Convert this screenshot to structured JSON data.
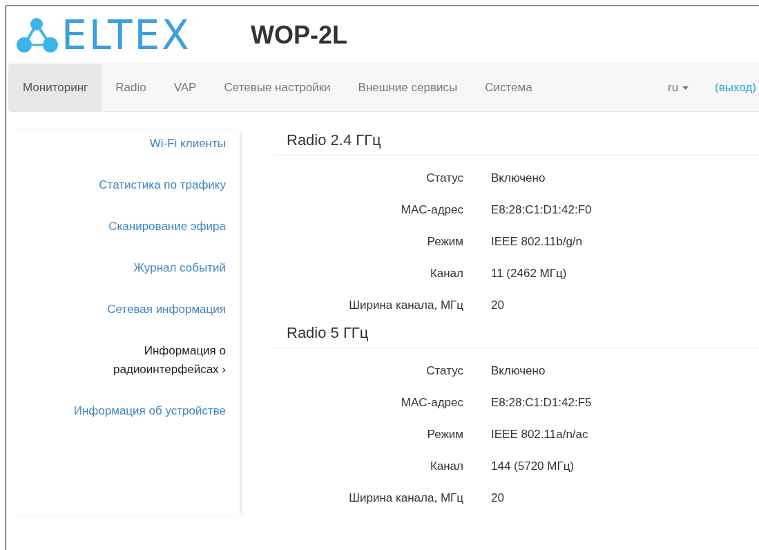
{
  "logo": {
    "text": "ELTEX"
  },
  "title": "WOP-2L",
  "tabs": [
    {
      "label": "Мониторинг",
      "selected": true
    },
    {
      "label": "Radio",
      "selected": false
    },
    {
      "label": "VAP",
      "selected": false
    },
    {
      "label": "Сетевые настройки",
      "selected": false
    },
    {
      "label": "Внешние сервисы",
      "selected": false
    },
    {
      "label": "Система",
      "selected": false
    }
  ],
  "language": "ru",
  "logout": "(выход)",
  "sidebar": {
    "items": [
      {
        "label": "Wi-Fi клиенты",
        "selected": false
      },
      {
        "label": "Статистика по трафику",
        "selected": false
      },
      {
        "label": "Сканирование эфира",
        "selected": false
      },
      {
        "label": "Журнал событий",
        "selected": false
      },
      {
        "label": "Сетевая информация",
        "selected": false
      },
      {
        "label": "Информация о радиоинтерфейсах ›",
        "selected": true
      },
      {
        "label": "Информация об устройстве",
        "selected": false
      }
    ]
  },
  "sections": [
    {
      "title": "Radio 2.4 ГГц",
      "rows": [
        {
          "label": "Статус",
          "value": "Включено"
        },
        {
          "label": "MAC-адрес",
          "value": "E8:28:C1:D1:42:F0"
        },
        {
          "label": "Режим",
          "value": "IEEE 802.11b/g/n"
        },
        {
          "label": "Канал",
          "value": "11 (2462 МГц)"
        },
        {
          "label": "Ширина канала, МГц",
          "value": "20"
        }
      ]
    },
    {
      "title": "Radio 5 ГГц",
      "rows": [
        {
          "label": "Статус",
          "value": "Включено"
        },
        {
          "label": "MAC-адрес",
          "value": "E8:28:C1:D1:42:F5"
        },
        {
          "label": "Режим",
          "value": "IEEE 802.11a/n/ac"
        },
        {
          "label": "Канал",
          "value": "144 (5720 МГц)"
        },
        {
          "label": "Ширина канала, МГц",
          "value": "20"
        }
      ]
    }
  ]
}
